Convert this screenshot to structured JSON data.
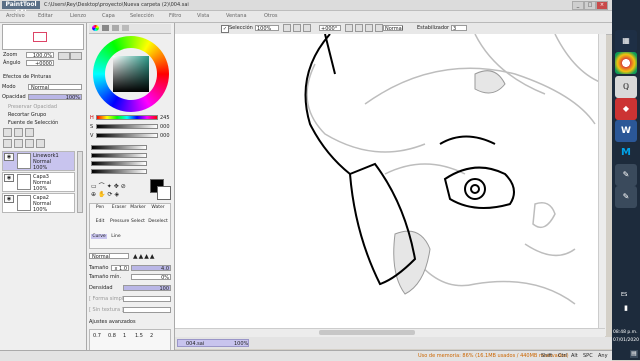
{
  "window": {
    "logo": "PaintTool SAI",
    "title_path": "C:\\Users\\Rey\\Desktop\\proyecto\\Nueva carpeta (2)\\004.sai",
    "controls": [
      "_",
      "□",
      "×"
    ]
  },
  "menu": [
    "Archivo",
    "Editar",
    "Lienzo",
    "Capa",
    "Selección",
    "Filtro",
    "Vista",
    "Ventana",
    "Otros"
  ],
  "canvas_toolbar": {
    "selection_label": "Selección",
    "zoom": "100%",
    "rotation": "+000°",
    "mode": "Normal",
    "stabilizer_label": "Estabilizador",
    "stabilizer_value": "3"
  },
  "navigator": {
    "zoom_label": "Zoom",
    "zoom_value": "100.0%",
    "angle_label": "Ángulo",
    "angle_value": "+0000"
  },
  "layer_panel": {
    "effects_label": "Efectos de Pinturas",
    "mode_label": "Modo",
    "mode_value": "Normal",
    "opacity_label": "Opacidad",
    "opacity_value": "100%",
    "preserve_opacity": "Preservar Opacidad",
    "clip_group": "Recortar Grupo",
    "selection_source": "Fuente de Selección",
    "layers": [
      {
        "name": "Linework1",
        "mode": "Normal",
        "opacity": "100%",
        "selected": true
      },
      {
        "name": "Capa3",
        "mode": "Normal",
        "opacity": "100%",
        "selected": false
      },
      {
        "name": "Capa2",
        "mode": "Normal",
        "opacity": "100%",
        "selected": false
      }
    ]
  },
  "color_panel": {
    "h_label": "H",
    "h_value": "245",
    "s_label": "S",
    "s_value": "000",
    "v_label": "V",
    "v_value": "000",
    "accent": "#2c2f87"
  },
  "tools": {
    "row1": [
      "Pen",
      "Eraser",
      "Marker",
      "Water"
    ],
    "row2": [
      "Edit",
      "Pressure",
      "Select",
      "Deselect"
    ],
    "row3": [
      "Curve",
      "Line"
    ]
  },
  "brush": {
    "shape_label": "Normal",
    "size_label": "Tamaño",
    "size_multiplier": "x 1.0",
    "size_value": "4.0",
    "min_size_label": "Tamaño mín.",
    "min_size_value": "0%",
    "density_label": "Densidad",
    "density_value": "100",
    "blend_simple": "[ Forma simple ]",
    "blend_texture": "[ Sin textura ]",
    "advanced_label": "Ajustes avanzados",
    "presets": [
      "0.7",
      "0.8",
      "1",
      "1.5",
      "2"
    ]
  },
  "document_tab": {
    "name": "004.sai",
    "zoom": "100%"
  },
  "status": {
    "memory": "Uso de memoria: 86% (16.1MB usados / 440MB reservados)",
    "keys": [
      "Shift",
      "Ctrl",
      "Alt",
      "SPC",
      "Any"
    ]
  },
  "taskbar": {
    "language": "ES",
    "time": "08:48 p.m.",
    "date": "07/01/2020"
  }
}
